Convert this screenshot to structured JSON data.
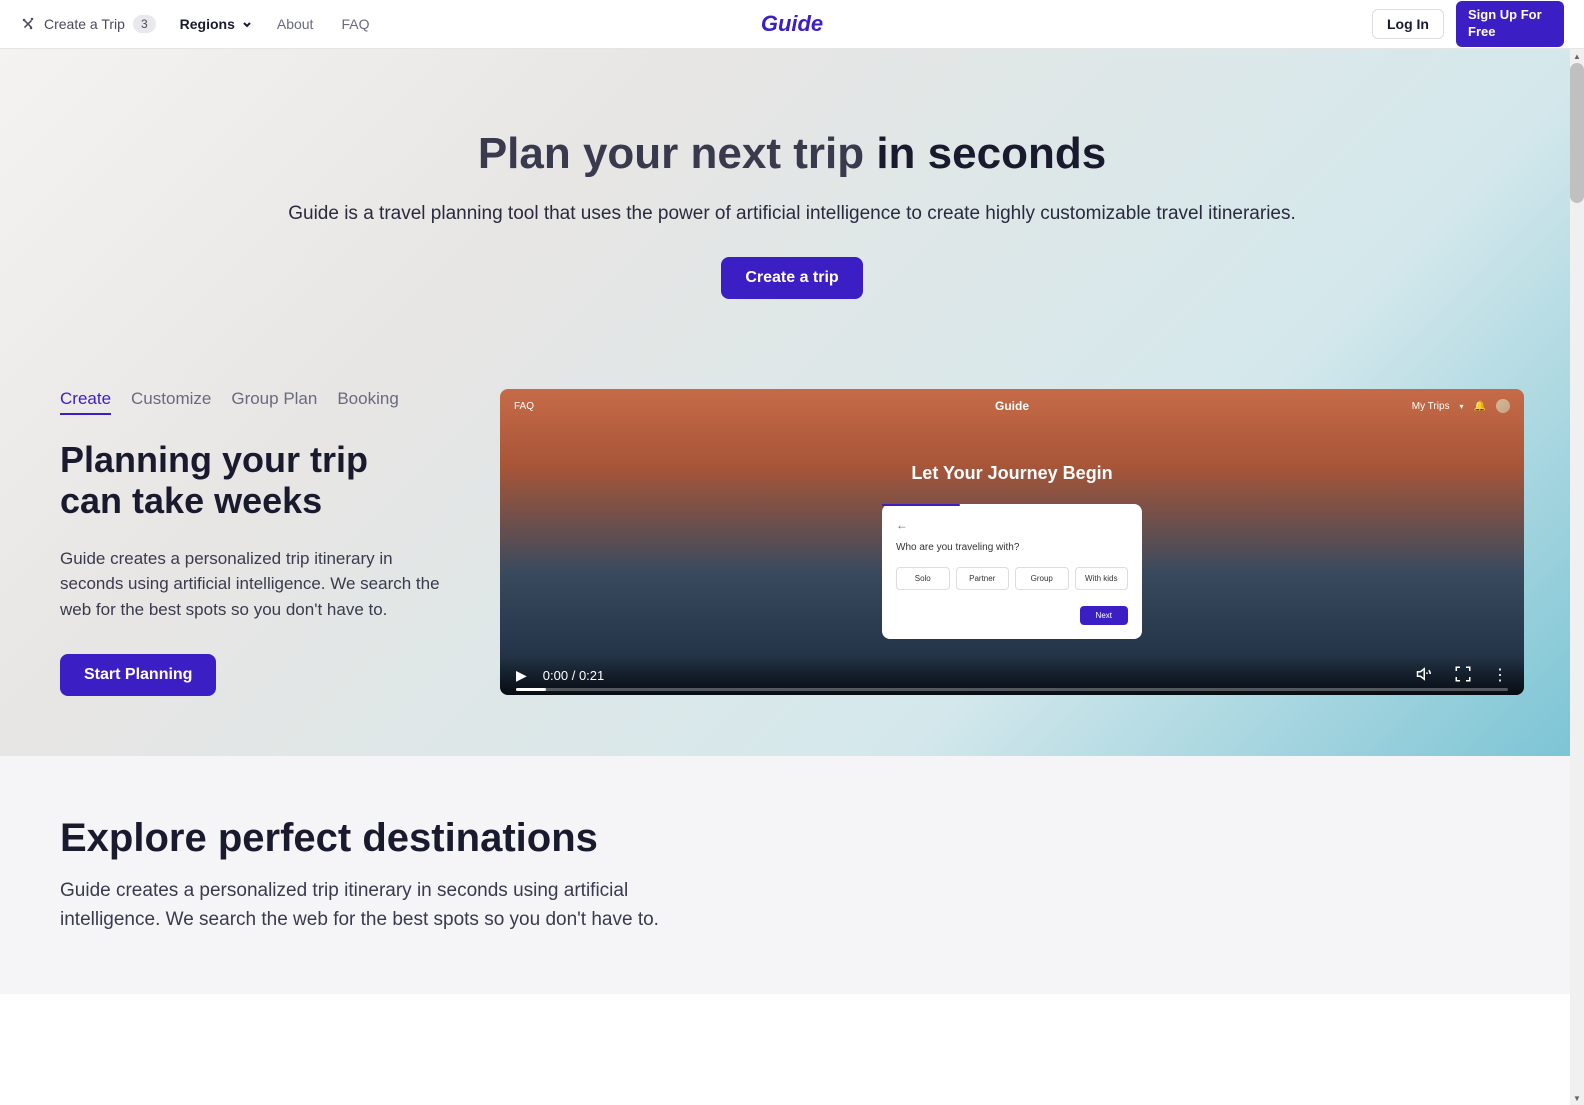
{
  "header": {
    "create_trip_label": "Create a Trip",
    "create_trip_badge": "3",
    "regions_label": "Regions",
    "about_label": "About",
    "faq_label": "FAQ",
    "logo": "Guide",
    "login_label": "Log In",
    "signup_label": "Sign Up For Free"
  },
  "hero": {
    "title_prefix": "Plan your next trip ",
    "title_bold": "in seconds",
    "subtitle": "Guide is a travel planning tool that uses the power of artificial intelligence to create highly customizable travel itineraries.",
    "cta_label": "Create a trip"
  },
  "tabs": [
    {
      "label": "Create",
      "active": true
    },
    {
      "label": "Customize",
      "active": false
    },
    {
      "label": "Group Plan",
      "active": false
    },
    {
      "label": "Booking",
      "active": false
    }
  ],
  "feature": {
    "title": "Planning your trip can take weeks",
    "description": "Guide creates a personalized trip itinerary in seconds using artificial intelligence. We search the web for the best spots so you don't have to.",
    "cta_label": "Start Planning"
  },
  "video_preview": {
    "nav_faq": "FAQ",
    "logo": "Guide",
    "my_trips_label": "My Trips",
    "main_title": "Let Your Journey Begin",
    "question": "Who are you traveling with?",
    "options": [
      "Solo",
      "Partner",
      "Group",
      "With kids"
    ],
    "next_label": "Next",
    "time_current": "0:00",
    "time_total": "0:21"
  },
  "explore": {
    "title": "Explore perfect destinations",
    "subtitle": "Guide creates a personalized trip itinerary in seconds using artificial intelligence. We search the web for the best spots so you don't have to."
  },
  "colors": {
    "primary": "#3b1fc5"
  }
}
